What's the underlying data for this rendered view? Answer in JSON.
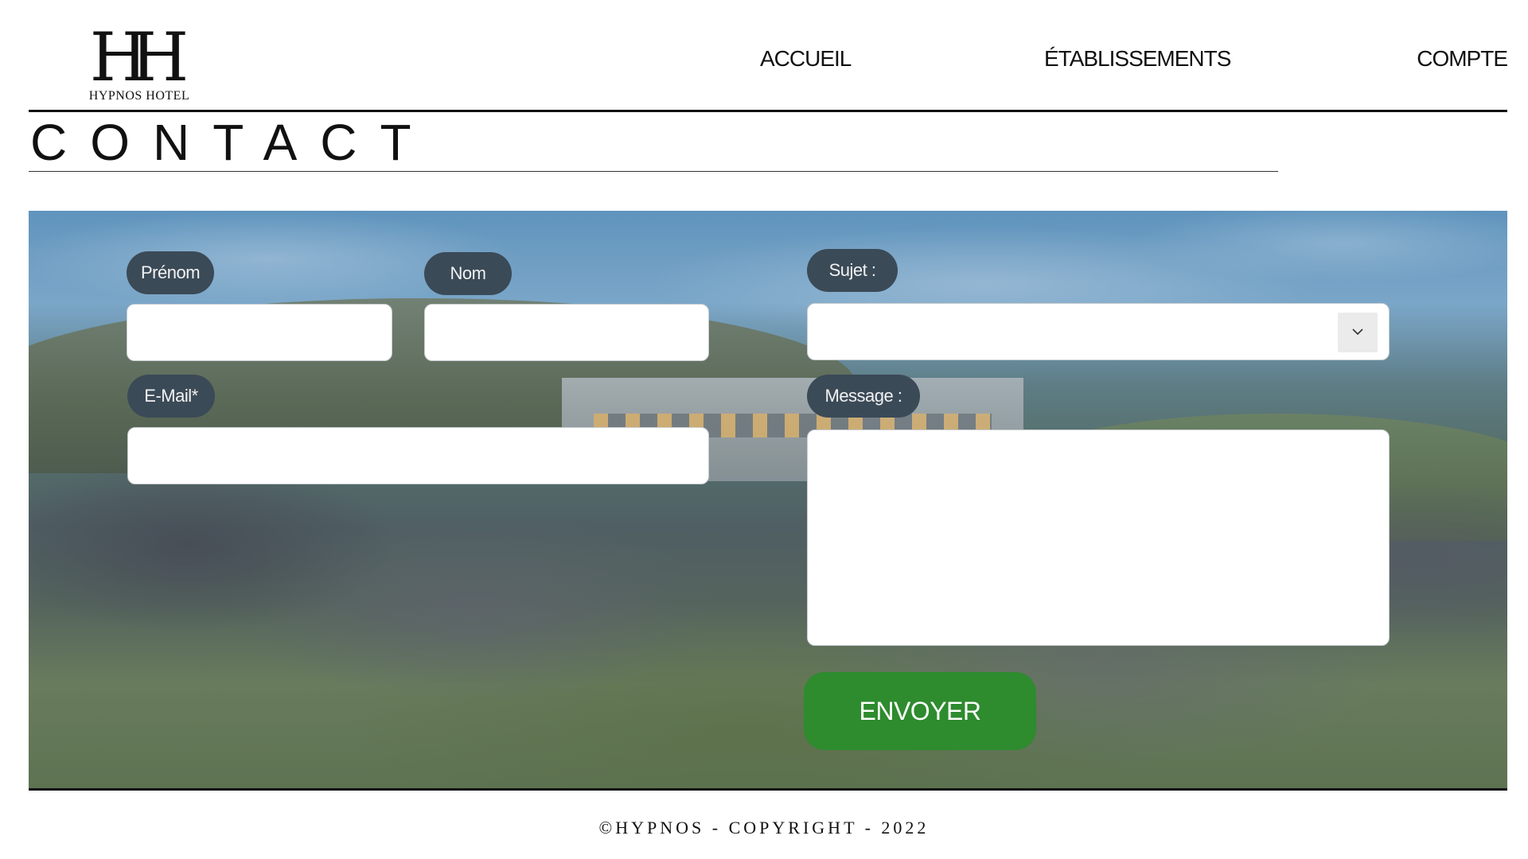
{
  "logo": {
    "mark": "HH",
    "name": "HYPNOS HOTEL"
  },
  "nav": {
    "items": [
      {
        "label": "ACCUEIL"
      },
      {
        "label": "ÉTABLISSEMENTS"
      },
      {
        "label": "COMPTE"
      }
    ]
  },
  "page": {
    "title": "CONTACT"
  },
  "form": {
    "prenom": {
      "label": "Prénom",
      "value": "",
      "placeholder": ""
    },
    "nom": {
      "label": "Nom",
      "value": "",
      "placeholder": ""
    },
    "email": {
      "label": "E-Mail*",
      "value": "",
      "placeholder": ""
    },
    "sujet": {
      "label": "Sujet :",
      "value": ""
    },
    "message": {
      "label": "Message :",
      "value": "",
      "placeholder": ""
    },
    "submit_label": "ENVOYER"
  },
  "colors": {
    "label_bg": "#3b4a57",
    "button_bg": "#2e8b2e"
  },
  "footer": {
    "copyright": "©HYPNOS - COPYRIGHT - 2022"
  }
}
